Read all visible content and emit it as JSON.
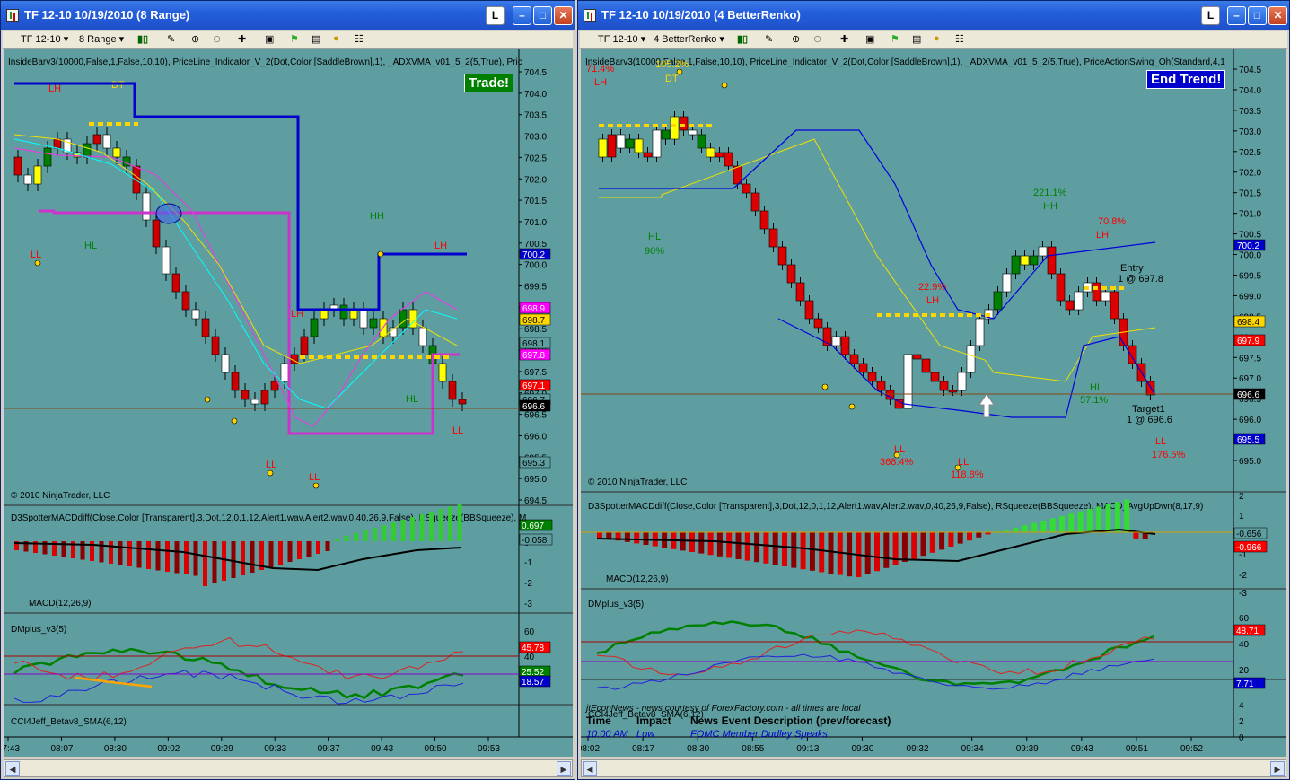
{
  "left": {
    "title": "TF 12-10  10/19/2010 (8 Range)",
    "toolbar": {
      "instrument": "TF 12-10",
      "period": "8 Range"
    },
    "indicator_label": "InsideBarv3(10000,False,1,False,10,10), PriceLine_Indicator_V_2(Dot,Color [SaddleBrown],1), _ADXVMA_v01_5_2(5,True), Pric",
    "badge": "Trade!",
    "copyright": "© 2010 NinjaTrader, LLC",
    "macd_label": "D3SpotterMACDdiff(Close,Color [Transparent],3,Dot,12,0,1,12,Alert1.wav,Alert2.wav,0,40,26,9,False), RSqueeze(BBSqueeze), M",
    "macd_sub": "MACD(12,26,9)",
    "dm_label": "DMplus_v3(5)",
    "cci_label": "CCI4Jeff_Betav8_SMA(6,12)",
    "price_ticks": [
      "704.5",
      "704.0",
      "703.5",
      "703.0",
      "702.5",
      "702.0",
      "701.5",
      "701.0",
      "700.5",
      "700.0",
      "699.5",
      "699.0",
      "698.5",
      "698.0",
      "697.5",
      "697.0",
      "696.5",
      "696.0",
      "695.5",
      "695.0",
      "694.5"
    ],
    "price_tags": [
      {
        "text": "700.2",
        "bg": "#0000cc",
        "fg": "#ffffff"
      },
      {
        "text": "698.9",
        "bg": "#ff00ff",
        "fg": "#ffffff"
      },
      {
        "text": "698.7",
        "bg": "#ffd700",
        "fg": "#000000"
      },
      {
        "text": "698.1",
        "bg": "#5f9ea0",
        "fg": "#000000"
      },
      {
        "text": "697.8",
        "bg": "#ff00ff",
        "fg": "#ffffff"
      },
      {
        "text": "697.1",
        "bg": "#ff0000",
        "fg": "#ffffff"
      },
      {
        "text": "696.7",
        "bg": "#5f9ea0",
        "fg": "#000000"
      },
      {
        "text": "696.6",
        "bg": "#000000",
        "fg": "#ffffff"
      },
      {
        "text": "695.3",
        "bg": "#5f9ea0",
        "fg": "#000000"
      }
    ],
    "macd_ticks": [
      "0",
      "-1",
      "-2",
      "-3"
    ],
    "macd_tags": [
      {
        "text": "0.697",
        "bg": "#008000",
        "fg": "#ffffff"
      },
      {
        "text": "-0.058",
        "bg": "#5f9ea0",
        "fg": "#000000"
      }
    ],
    "dm_ticks": [
      "60",
      "40",
      "20"
    ],
    "dm_tags": [
      {
        "text": "45.78",
        "bg": "#ff0000",
        "fg": "#ffffff"
      },
      {
        "text": "25.52",
        "bg": "#008000",
        "fg": "#ffffff"
      },
      {
        "text": "18.57",
        "bg": "#0000cc",
        "fg": "#ffffff"
      }
    ],
    "time_ticks": [
      "07:43",
      "08:07",
      "08:30",
      "09:02",
      "09:29",
      "09:33",
      "09:37",
      "09:43",
      "09:50",
      "09:53"
    ],
    "annotations": [
      {
        "text": "LH",
        "color": "#ff0000"
      },
      {
        "text": "DT",
        "color": "#ffd700"
      },
      {
        "text": "HL",
        "color": "#008000"
      },
      {
        "text": "LL",
        "color": "#ff0000"
      },
      {
        "text": "HH",
        "color": "#008000"
      },
      {
        "text": "LH",
        "color": "#ff0000"
      },
      {
        "text": "LH",
        "color": "#ff0000"
      },
      {
        "text": "HL",
        "color": "#008000"
      },
      {
        "text": "LL",
        "color": "#ff0000"
      },
      {
        "text": "LL",
        "color": "#ff0000"
      },
      {
        "text": "LL",
        "color": "#ff0000"
      }
    ]
  },
  "right": {
    "title": "TF 12-10  10/19/2010 (4 BetterRenko)",
    "toolbar": {
      "instrument": "TF 12-10",
      "period": "4 BetterRenko"
    },
    "indicator_label": "InsideBarv3(10000,False,1,False,10,10), PriceLine_Indicator_V_2(Dot,Color [SaddleBrown],1), _ADXVMA_v01_5_2(5,True), PriceActionSwing_Oh(Standard,4,1",
    "badge": "End Trend!",
    "copyright": "© 2010 NinjaTrader, LLC",
    "macd_label": "D3SpotterMACDdiff(Close,Color [Transparent],3,Dot,12,0,1,12,Alert1.wav,Alert2.wav,0,40,26,9,False), RSqueeze(BBSqueeze), MACD_AvgUpDwn(8,17,9)",
    "macd_sub": "MACD(12,26,9)",
    "dm_label": "DMplus_v3(5)",
    "cci_label": "CCI4Jeff_Betav8_SMA(6,12)",
    "price_ticks": [
      "704.5",
      "704.0",
      "703.5",
      "703.0",
      "702.5",
      "702.0",
      "701.5",
      "701.0",
      "700.5",
      "700.0",
      "699.5",
      "699.0",
      "698.5",
      "698.0",
      "697.5",
      "697.0",
      "696.5",
      "696.0",
      "695.5",
      "695.0"
    ],
    "price_tags": [
      {
        "text": "700.2",
        "bg": "#0000cc",
        "fg": "#ffffff"
      },
      {
        "text": "698.4",
        "bg": "#ffd700",
        "fg": "#000000"
      },
      {
        "text": "697.9",
        "bg": "#ff0000",
        "fg": "#ffffff"
      },
      {
        "text": "696.6",
        "bg": "#000000",
        "fg": "#ffffff"
      },
      {
        "text": "695.5",
        "bg": "#0000cc",
        "fg": "#ffffff"
      }
    ],
    "macd_ticks": [
      "2",
      "1",
      "0",
      "-1",
      "-2",
      "-3"
    ],
    "macd_tags": [
      {
        "text": "-0.656",
        "bg": "#5f9ea0",
        "fg": "#000000"
      },
      {
        "text": "-0.966",
        "bg": "#ff0000",
        "fg": "#ffffff"
      }
    ],
    "dm_ticks": [
      "60",
      "40",
      "20"
    ],
    "dm_tags": [
      {
        "text": "48.71",
        "bg": "#ff0000",
        "fg": "#ffffff"
      },
      {
        "text": "7.71",
        "bg": "#0000cc",
        "fg": "#ffffff"
      }
    ],
    "cci_ticks": [
      "4",
      "2",
      "0"
    ],
    "time_ticks": [
      "08:02",
      "08:17",
      "08:30",
      "08:55",
      "09:13",
      "09:30",
      "09:32",
      "09:34",
      "09:39",
      "09:43",
      "09:51",
      "09:52"
    ],
    "news": {
      "header_note": "jtEconNews - news courtesy of ForexFactory.com - all times are local",
      "col_time": "Time",
      "col_impact": "Impact",
      "col_desc": "News Event Description (prev/forecast)",
      "row_time": "10:00 AM",
      "row_impact": "Low",
      "row_desc": "FOMC Member Dudley Speaks"
    },
    "annotations": [
      {
        "text": "71.4%",
        "color": "#ff0000"
      },
      {
        "text": "105.2%",
        "color": "#ffd700"
      },
      {
        "text": "LH",
        "color": "#ff0000"
      },
      {
        "text": "DT",
        "color": "#ffd700"
      },
      {
        "text": "221.1%",
        "color": "#008000"
      },
      {
        "text": "HH",
        "color": "#008000"
      },
      {
        "text": "70.8%",
        "color": "#ff0000"
      },
      {
        "text": "LH",
        "color": "#ff0000"
      },
      {
        "text": "HL",
        "color": "#008000"
      },
      {
        "text": "90%",
        "color": "#008000"
      },
      {
        "text": "22.9%",
        "color": "#ff0000"
      },
      {
        "text": "LH",
        "color": "#ff0000"
      },
      {
        "text": "Entry",
        "color": "#000000"
      },
      {
        "text": "1 @ 697.8",
        "color": "#000000"
      },
      {
        "text": "HL",
        "color": "#008000"
      },
      {
        "text": "57.1%",
        "color": "#008000"
      },
      {
        "text": "Target1",
        "color": "#000000"
      },
      {
        "text": "1 @ 696.6",
        "color": "#000000"
      },
      {
        "text": "LL",
        "color": "#ff0000"
      },
      {
        "text": "368.4%",
        "color": "#ff0000"
      },
      {
        "text": "LL",
        "color": "#ff0000"
      },
      {
        "text": "118.8%",
        "color": "#ff0000"
      },
      {
        "text": "LL",
        "color": "#ff0000"
      },
      {
        "text": "176.5%",
        "color": "#ff0000"
      }
    ]
  }
}
